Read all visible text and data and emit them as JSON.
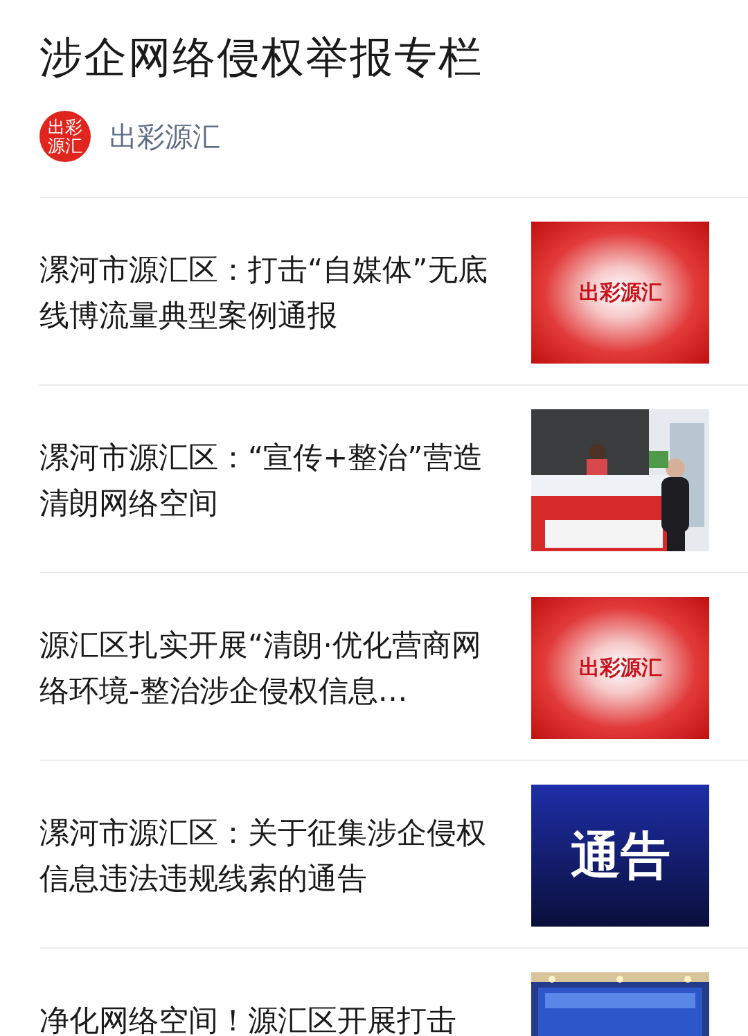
{
  "title": "涉企网络侵权举报专栏",
  "author": {
    "avatar_text": "出彩源汇",
    "name": "出彩源汇"
  },
  "articles": [
    {
      "title": "漯河市源汇区：打击“自媒体”无底线博流量典型案例通报",
      "thumb": {
        "kind": "banner",
        "text": "出彩源汇"
      }
    },
    {
      "title": "漯河市源汇区：“宣传+整治”营造清朗网络空间"
    },
    {
      "title": "源汇区扎实开展“清朗·优化营商网络环境-整治涉企侵权信息…",
      "thumb": {
        "kind": "banner",
        "text": "出彩源汇"
      }
    },
    {
      "title": "漯河市源汇区：关于征集涉企侵权信息违法违规线索的通告",
      "thumb": {
        "kind": "notice",
        "text": "通告"
      }
    },
    {
      "title": "净化网络空间！源汇区开展打击",
      "thumb": {
        "kind": "stage"
      }
    }
  ]
}
